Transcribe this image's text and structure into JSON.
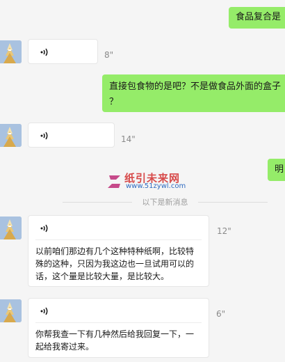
{
  "messages": {
    "m1": {
      "text": "食品复合是"
    },
    "m2": {
      "duration": "8\""
    },
    "m3": {
      "line1": "直接包食物的是吧？不是做食品外面的盒子",
      "line2": "？"
    },
    "m4": {
      "duration": "14\""
    },
    "m5": {
      "text": "明"
    },
    "m6": {
      "duration": "12\"",
      "transcript": "以前咱们那边有几个这种特种纸啊，比较特殊的这种，只因为我这边也一旦试用可以的话，这个量是比较大量，是比较大。"
    },
    "m7": {
      "duration": "6\"",
      "transcript": "你帮我查一下有几种然后给我回复一下，一起给我寄过来。"
    }
  },
  "new_messages_divider": "以下是新消息",
  "watermark": {
    "title": "纸引未来网",
    "url": "www.51zywl.com",
    "logo_text": "纸引未来"
  },
  "colors": {
    "outgoing_bubble": "#95ec69",
    "incoming_bubble": "#ffffff",
    "background": "#f5f5f5"
  }
}
